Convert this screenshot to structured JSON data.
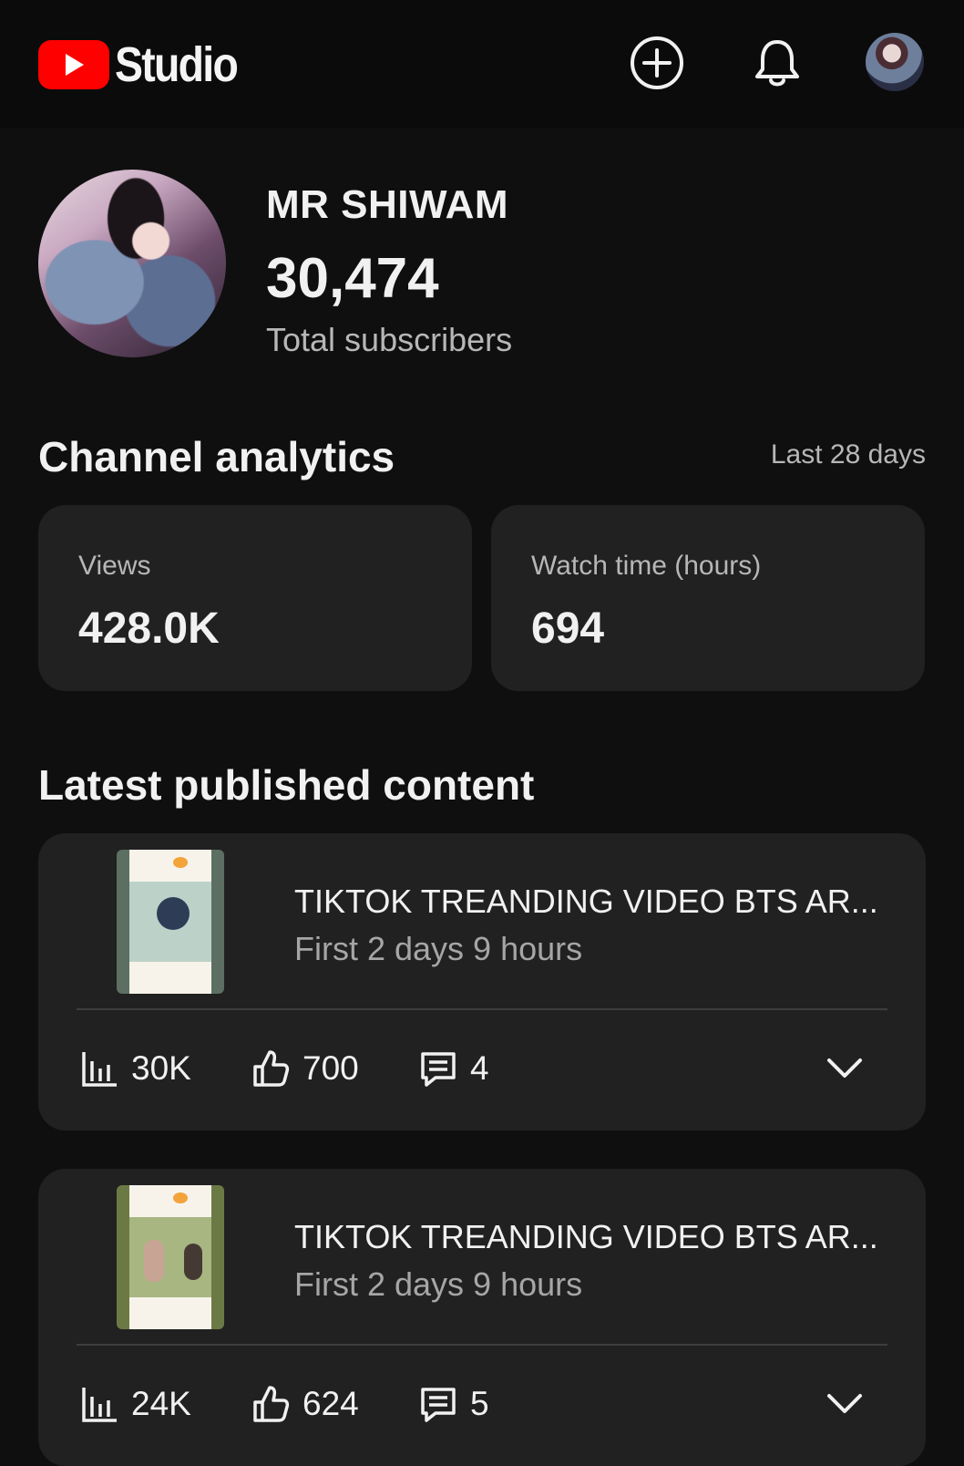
{
  "header": {
    "app_name": "Studio",
    "icons": [
      "youtube-logo",
      "create-icon",
      "bell-icon",
      "account-avatar"
    ]
  },
  "channel": {
    "name": "MR SHIWAM",
    "subscribers": "30,474",
    "subscribers_label": "Total subscribers"
  },
  "analytics": {
    "title": "Channel analytics",
    "period": "Last 28 days",
    "cards": [
      {
        "label": "Views",
        "value": "428.0K"
      },
      {
        "label": "Watch time (hours)",
        "value": "694"
      }
    ]
  },
  "latest": {
    "title": "Latest published content",
    "videos": [
      {
        "title": "TIKTOK TREANDING VIDEO BTS AR...",
        "meta": "First 2 days 9 hours",
        "views": "30K",
        "likes": "700",
        "comments": "4"
      },
      {
        "title": "TIKTOK TREANDING VIDEO BTS AR...",
        "meta": "First 2 days 9 hours",
        "views": "24K",
        "likes": "624",
        "comments": "5"
      }
    ]
  },
  "colors": {
    "background": "#0f0f0f",
    "card": "#212121",
    "brand_red": "#ff0000",
    "text_primary": "#f1f1f1",
    "text_secondary": "#b7b7b7"
  }
}
